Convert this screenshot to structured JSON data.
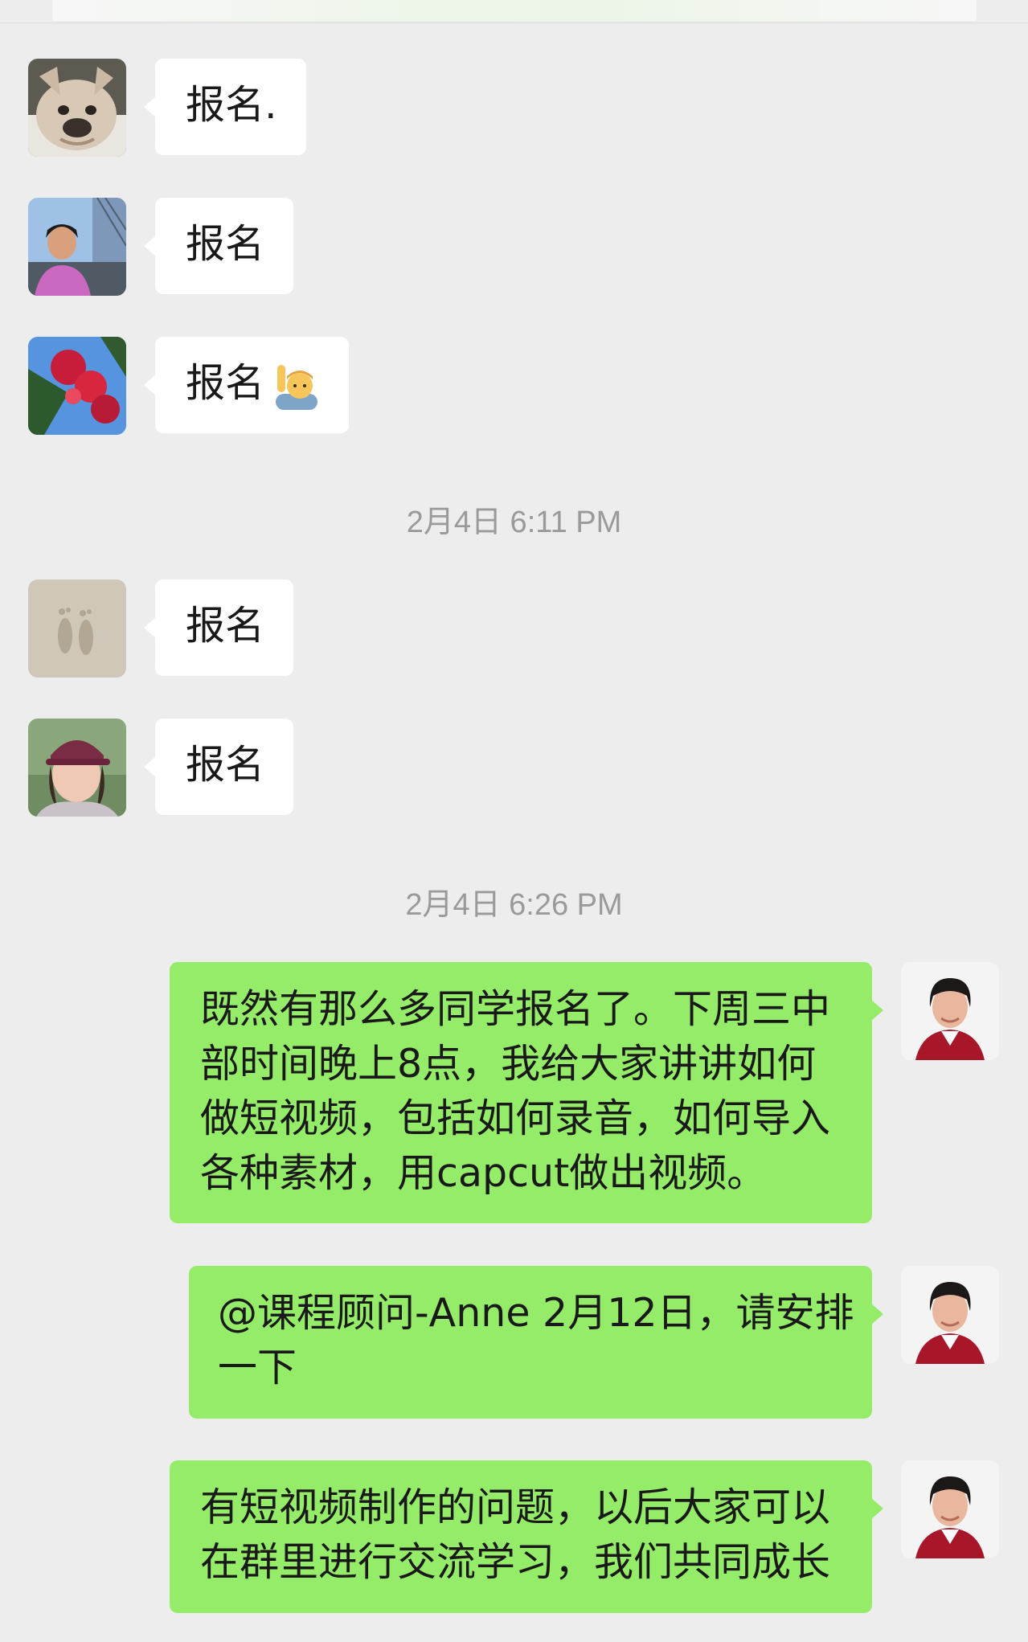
{
  "chat": {
    "messages": [
      {
        "side": "left",
        "avatar": "french-bulldog-avatar",
        "text": "报名."
      },
      {
        "side": "left",
        "avatar": "woman-bridge-avatar",
        "text": "报名"
      },
      {
        "side": "left",
        "avatar": "red-flower-avatar",
        "text": "报名",
        "emoji": "person-raising-hand"
      },
      {
        "side": "left",
        "avatar": "footprints-avatar",
        "text": "报名"
      },
      {
        "side": "left",
        "avatar": "woman-cap-avatar",
        "text": "报名"
      },
      {
        "side": "right",
        "avatar": "woman-red-jacket-avatar",
        "lines": [
          "既然有那么多同学报名了。下周三中",
          "部时间晚上8点，我给大家讲讲如何",
          "做短视频，包括如何录音，如何导入",
          "各种素材，用capcut做出视频。"
        ]
      },
      {
        "side": "right",
        "avatar": "woman-red-jacket-avatar",
        "lines": [
          "@课程顾问-Anne 2月12日，请安排",
          "一下"
        ]
      },
      {
        "side": "right",
        "avatar": "woman-red-jacket-avatar",
        "lines": [
          "有短视频制作的问题，以后大家可以",
          "在群里进行交流学习，我们共同成长"
        ]
      }
    ],
    "timestamps": [
      "2月4日 6:11 PM",
      "2月4日 6:26 PM"
    ]
  },
  "colors": {
    "background": "#ededed",
    "incoming_bubble": "#ffffff",
    "outgoing_bubble": "#95ec69",
    "timestamp_text": "#9a9a9a"
  }
}
